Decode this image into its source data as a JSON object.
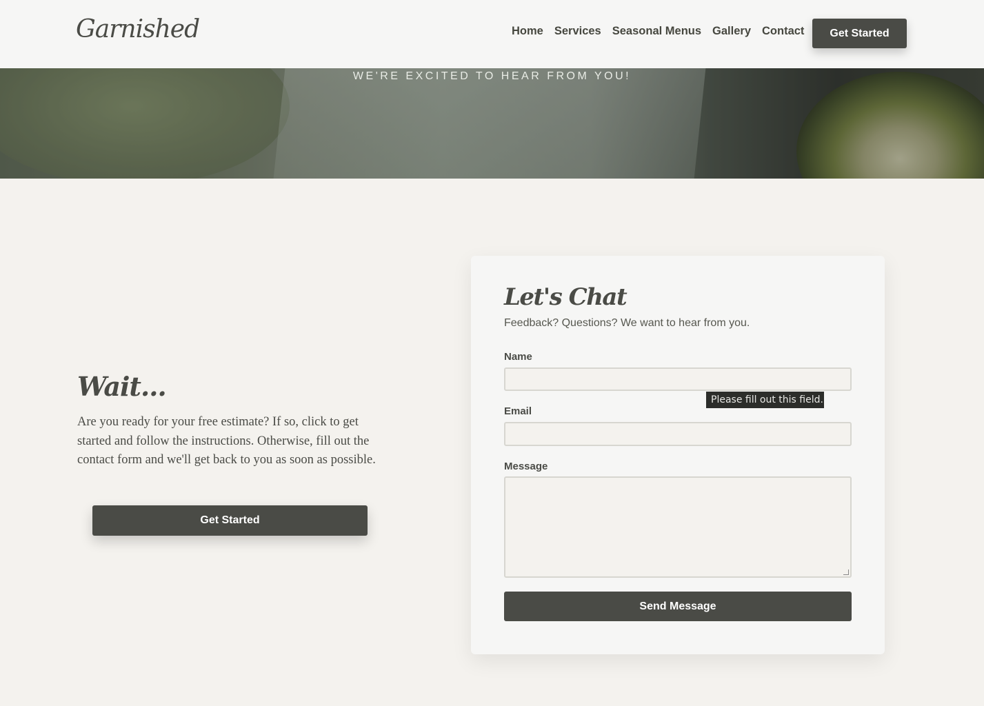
{
  "header": {
    "logo": "Garnished",
    "nav": [
      "Home",
      "Services",
      "Seasonal Menus",
      "Gallery",
      "Contact"
    ],
    "cta_label": "Get Started"
  },
  "hero": {
    "tagline": "WE'RE EXCITED TO HEAR FROM YOU!"
  },
  "left": {
    "title": "Wait...",
    "body": "Are you ready for your free estimate? If so, click to get started and follow the instructions. Otherwise, fill out the contact form and we'll get back to you as soon as possible.",
    "cta_label": "Get Started"
  },
  "form": {
    "title": "Let's Chat",
    "subtitle": "Feedback? Questions? We want to hear from you.",
    "name_label": "Name",
    "email_label": "Email",
    "message_label": "Message",
    "submit_label": "Send Message",
    "validation_tooltip": "Please fill out this field."
  }
}
